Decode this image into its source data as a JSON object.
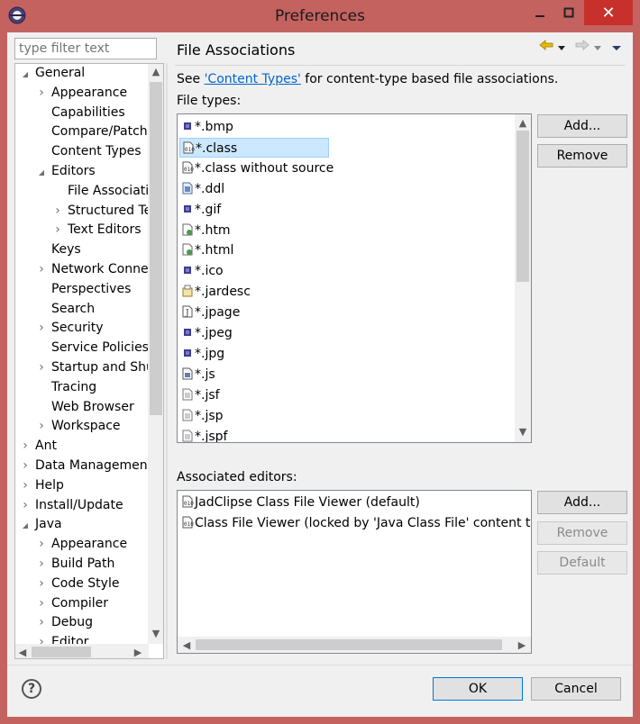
{
  "window": {
    "title": "Preferences"
  },
  "filter": {
    "placeholder": "type filter text"
  },
  "tree": [
    {
      "label": "General",
      "depth": 0,
      "twisty": "open"
    },
    {
      "label": "Appearance",
      "depth": 1,
      "twisty": "closed"
    },
    {
      "label": "Capabilities",
      "depth": 1,
      "twisty": "none"
    },
    {
      "label": "Compare/Patch",
      "depth": 1,
      "twisty": "none"
    },
    {
      "label": "Content Types",
      "depth": 1,
      "twisty": "none"
    },
    {
      "label": "Editors",
      "depth": 1,
      "twisty": "open"
    },
    {
      "label": "File Associations",
      "depth": 2,
      "twisty": "none",
      "selected": true
    },
    {
      "label": "Structured Text Editors",
      "depth": 2,
      "twisty": "closed"
    },
    {
      "label": "Text Editors",
      "depth": 2,
      "twisty": "closed"
    },
    {
      "label": "Keys",
      "depth": 1,
      "twisty": "none"
    },
    {
      "label": "Network Connections",
      "depth": 1,
      "twisty": "closed"
    },
    {
      "label": "Perspectives",
      "depth": 1,
      "twisty": "none"
    },
    {
      "label": "Search",
      "depth": 1,
      "twisty": "none"
    },
    {
      "label": "Security",
      "depth": 1,
      "twisty": "closed"
    },
    {
      "label": "Service Policies",
      "depth": 1,
      "twisty": "none"
    },
    {
      "label": "Startup and Shutdown",
      "depth": 1,
      "twisty": "closed"
    },
    {
      "label": "Tracing",
      "depth": 1,
      "twisty": "none"
    },
    {
      "label": "Web Browser",
      "depth": 1,
      "twisty": "none"
    },
    {
      "label": "Workspace",
      "depth": 1,
      "twisty": "closed"
    },
    {
      "label": "Ant",
      "depth": 0,
      "twisty": "closed"
    },
    {
      "label": "Data Management",
      "depth": 0,
      "twisty": "closed"
    },
    {
      "label": "Help",
      "depth": 0,
      "twisty": "closed"
    },
    {
      "label": "Install/Update",
      "depth": 0,
      "twisty": "closed"
    },
    {
      "label": "Java",
      "depth": 0,
      "twisty": "open"
    },
    {
      "label": "Appearance",
      "depth": 1,
      "twisty": "closed"
    },
    {
      "label": "Build Path",
      "depth": 1,
      "twisty": "closed"
    },
    {
      "label": "Code Style",
      "depth": 1,
      "twisty": "closed"
    },
    {
      "label": "Compiler",
      "depth": 1,
      "twisty": "closed"
    },
    {
      "label": "Debug",
      "depth": 1,
      "twisty": "closed"
    },
    {
      "label": "Editor",
      "depth": 1,
      "twisty": "closed"
    }
  ],
  "page": {
    "title": "File Associations",
    "see_prefix": "See ",
    "see_link": "'Content Types'",
    "see_suffix": " for content-type based file associations.",
    "file_types_label": "File types:",
    "associated_label": "Associated editors:"
  },
  "file_types": [
    {
      "name": "*.bmp",
      "icon": "image-icon"
    },
    {
      "name": "*.class",
      "icon": "class-file-icon",
      "selected": true
    },
    {
      "name": "*.class without source",
      "icon": "class-file-icon"
    },
    {
      "name": "*.ddl",
      "icon": "ddl-file-icon"
    },
    {
      "name": "*.gif",
      "icon": "image-icon"
    },
    {
      "name": "*.htm",
      "icon": "web-file-icon"
    },
    {
      "name": "*.html",
      "icon": "web-file-icon"
    },
    {
      "name": "*.ico",
      "icon": "image-icon"
    },
    {
      "name": "*.jardesc",
      "icon": "jar-icon"
    },
    {
      "name": "*.jpage",
      "icon": "java-scrapbook-icon"
    },
    {
      "name": "*.jpeg",
      "icon": "image-icon"
    },
    {
      "name": "*.jpg",
      "icon": "image-icon"
    },
    {
      "name": "*.js",
      "icon": "js-file-icon"
    },
    {
      "name": "*.jsf",
      "icon": "text-file-icon"
    },
    {
      "name": "*.jsp",
      "icon": "text-file-icon"
    },
    {
      "name": "*.jspf",
      "icon": "text-file-icon"
    }
  ],
  "editors": [
    {
      "name": "JadClipse Class File Viewer (default)",
      "icon": "class-file-icon"
    },
    {
      "name": "Class File Viewer (locked by 'Java Class File' content type)",
      "icon": "class-file-icon"
    }
  ],
  "buttons": {
    "add_type": "Add...",
    "remove_type": "Remove",
    "add_editor": "Add...",
    "remove_editor": "Remove",
    "default_editor": "Default",
    "ok": "OK",
    "cancel": "Cancel",
    "help": "?"
  },
  "colors": {
    "titlebar": "#c4625f",
    "close": "#c7302b",
    "link": "#0066cc",
    "selection": "#cce8ff"
  }
}
